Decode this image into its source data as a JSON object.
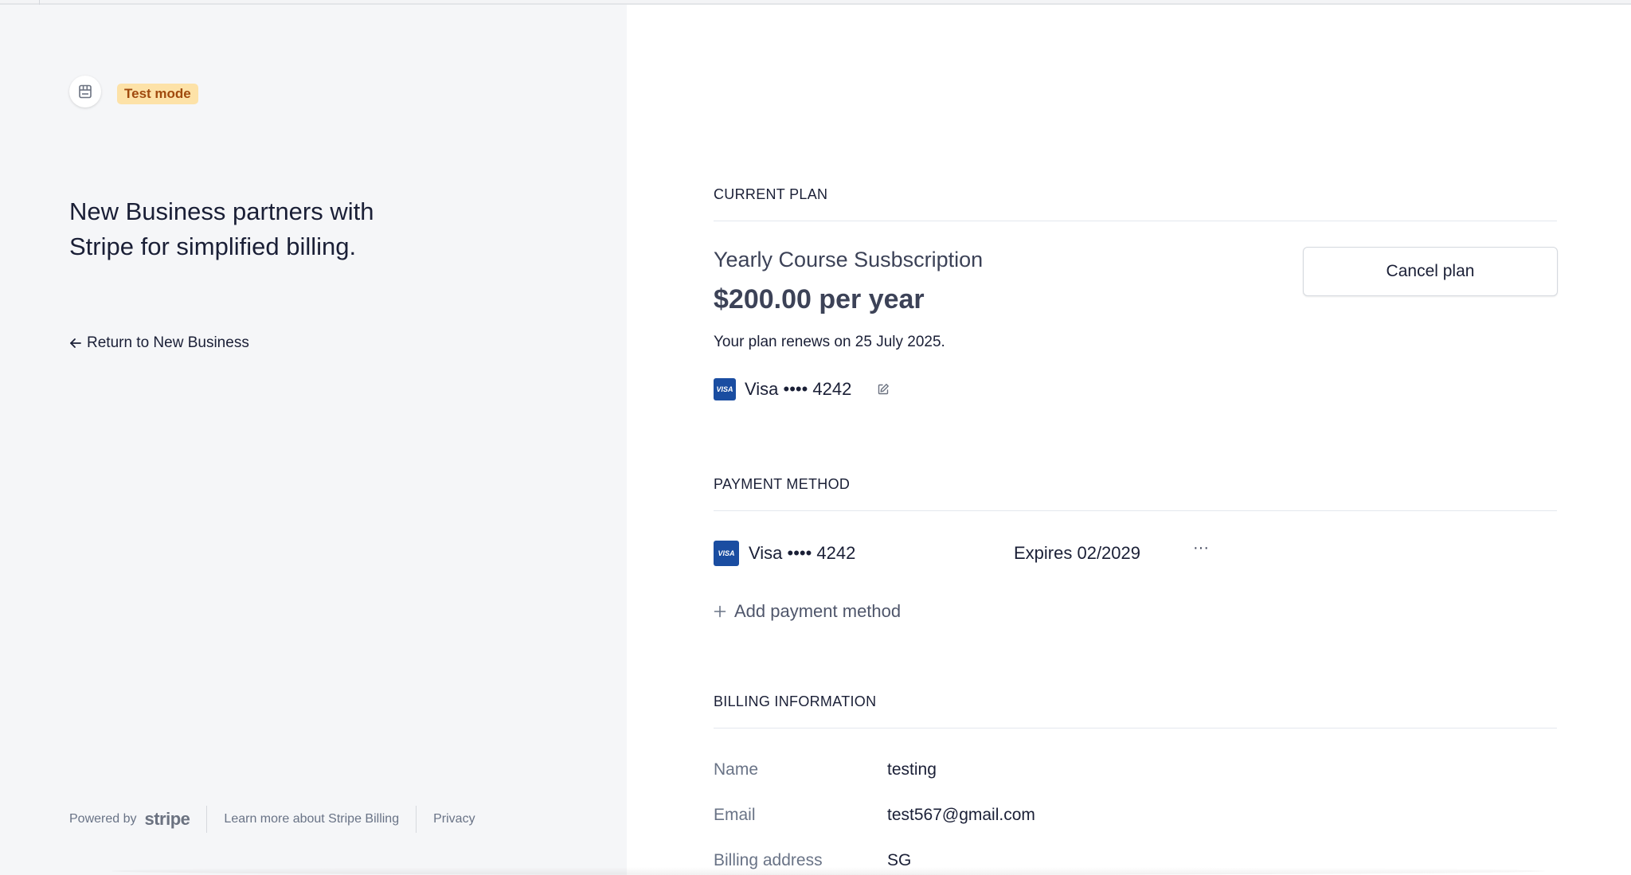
{
  "header": {
    "test_badge": "Test mode"
  },
  "left": {
    "headline": "New Business partners with Stripe for simplified billing.",
    "return_link": "Return to New Business",
    "footer": {
      "powered_by": "Powered by",
      "brand": "stripe",
      "learn_more": "Learn more about Stripe Billing",
      "privacy": "Privacy"
    }
  },
  "current_plan": {
    "section_title": "CURRENT PLAN",
    "plan_name": "Yearly Course Susbscription",
    "price": "$200.00 per year",
    "renewal": "Your plan renews on 25 July 2025.",
    "card_brand": "VISA",
    "card_label": "Visa •••• 4242",
    "cancel_label": "Cancel plan"
  },
  "payment_method": {
    "section_title": "PAYMENT METHOD",
    "card_brand": "VISA",
    "card_label": "Visa •••• 4242",
    "expires": "Expires 02/2029",
    "more_label": "···",
    "add_label": "Add payment method"
  },
  "billing_info": {
    "section_title": "BILLING INFORMATION",
    "rows": [
      {
        "key": "Name",
        "value": "testing"
      },
      {
        "key": "Email",
        "value": "test567@gmail.com"
      },
      {
        "key": "Billing address",
        "value": "SG"
      }
    ]
  },
  "colors": {
    "left_bg": "#f5f6f8",
    "badge_bg": "#fde2a8",
    "badge_text": "#a04a0e",
    "visa_blue": "#1a4da1"
  },
  "icons": [
    "store-icon",
    "arrow-left-icon",
    "edit-icon",
    "more-options-icon",
    "plus-icon"
  ]
}
